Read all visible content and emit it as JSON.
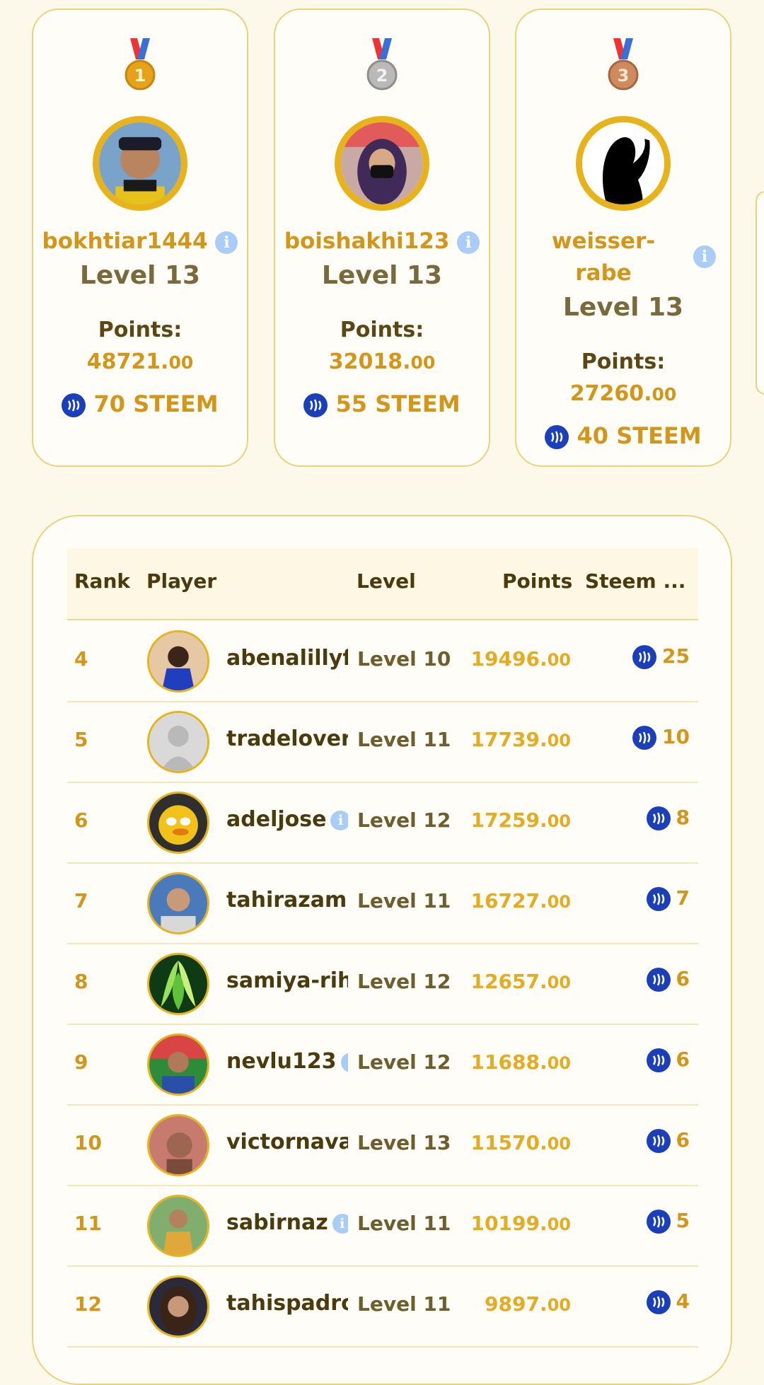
{
  "podium": [
    {
      "place": "1",
      "medal_color": "#e6a31a",
      "username": "bokhtiar1444",
      "level": "Level 13",
      "points_label": "Points:",
      "points_int": "48721.",
      "points_dec": "00",
      "steem": "70 STEEM",
      "avatar": "avatar-photo-man-cap"
    },
    {
      "place": "2",
      "medal_color": "#a9a9a9",
      "username": "boishakhi123",
      "level": "Level 13",
      "points_label": "Points:",
      "points_int": "32018.",
      "points_dec": "00",
      "steem": "55 STEEM",
      "avatar": "avatar-photo-woman-hijab"
    },
    {
      "place": "3",
      "medal_color": "#cf8a5e",
      "username_line1": "weisser-",
      "username_line2": "rabe",
      "level": "Level 13",
      "points_label": "Points:",
      "points_int": "27260.",
      "points_dec": "00",
      "steem": "40 STEEM",
      "avatar": "avatar-silhouette"
    }
  ],
  "table": {
    "headers": {
      "rank": "Rank",
      "player": "Player",
      "level": "Level",
      "points": "Points",
      "steem": "Steem ..."
    },
    "rows": [
      {
        "rank": "4",
        "name": "abenalillyf",
        "level": "Level 10",
        "points_int": "19496.",
        "points_dec": "00",
        "steem": "25"
      },
      {
        "rank": "5",
        "name": "tradelover",
        "level": "Level 11",
        "points_int": "17739.",
        "points_dec": "00",
        "steem": "10"
      },
      {
        "rank": "6",
        "name": "adeljose",
        "level": "Level 12",
        "points_int": "17259.",
        "points_dec": "00",
        "steem": "8"
      },
      {
        "rank": "7",
        "name": "tahirazam",
        "level": "Level 11",
        "points_int": "16727.",
        "points_dec": "00",
        "steem": "7"
      },
      {
        "rank": "8",
        "name": "samiya-rih",
        "level": "Level 12",
        "points_int": "12657.",
        "points_dec": "00",
        "steem": "6"
      },
      {
        "rank": "9",
        "name": "nevlu123",
        "level": "Level 12",
        "points_int": "11688.",
        "points_dec": "00",
        "steem": "6"
      },
      {
        "rank": "10",
        "name": "victornava",
        "level": "Level 13",
        "points_int": "11570.",
        "points_dec": "00",
        "steem": "6"
      },
      {
        "rank": "11",
        "name": "sabirnaz",
        "level": "Level 11",
        "points_int": "10199.",
        "points_dec": "00",
        "steem": "5"
      },
      {
        "rank": "12",
        "name": "tahispadro",
        "level": "Level 11",
        "points_int": "9897.",
        "points_dec": "00",
        "steem": "4"
      }
    ]
  },
  "colors": {
    "gold_text": "#d3961a",
    "steem_blue": "#1a3fb8",
    "info_blue": "#a9cdf6",
    "card_border": "#ecd27a"
  }
}
